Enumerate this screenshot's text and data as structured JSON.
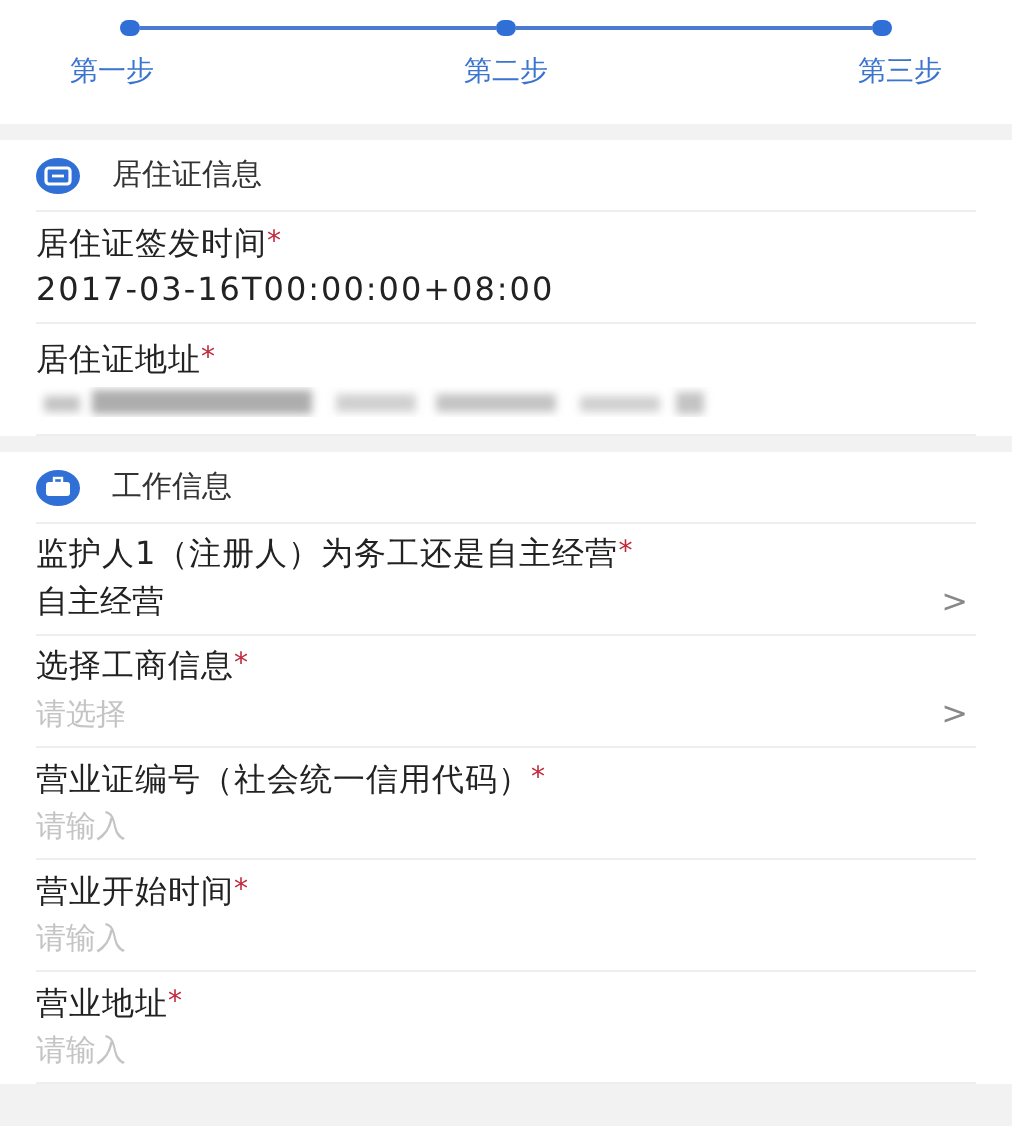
{
  "steps": [
    {
      "label": "第一步"
    },
    {
      "label": "第二步"
    },
    {
      "label": "第三步"
    }
  ],
  "sections": [
    {
      "title": "居住证信息",
      "fields": [
        {
          "kind": "value",
          "label": "居住证签发时间",
          "mark": "*",
          "value": "2017-03-16T00:00:00+08:00"
        },
        {
          "kind": "redacted",
          "label": "居住证地址",
          "mark": "*"
        }
      ]
    },
    {
      "title": "工作信息",
      "fields": [
        {
          "kind": "select",
          "label": "监护人1（注册人）为务工还是自主经营",
          "mark": "*",
          "value": "自主经营",
          "chevron": ">"
        },
        {
          "kind": "select",
          "label": "选择工商信息",
          "mark": "*",
          "placeholder": "请选择",
          "chevron": ">"
        },
        {
          "kind": "input",
          "label": "营业证编号（社会统一信用代码）",
          "mark": "*",
          "placeholder": "请输入"
        },
        {
          "kind": "input",
          "label": "营业开始时间",
          "mark": "*",
          "placeholder": "请输入"
        },
        {
          "kind": "input",
          "label": "营业地址",
          "mark": "*",
          "placeholder": "请输入"
        }
      ]
    }
  ]
}
